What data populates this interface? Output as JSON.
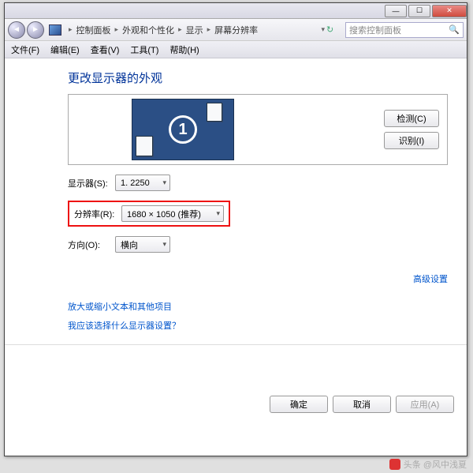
{
  "breadcrumbs": {
    "items": [
      "控制面板",
      "外观和个性化",
      "显示",
      "屏幕分辨率"
    ]
  },
  "search": {
    "placeholder": "搜索控制面板"
  },
  "menu": {
    "file": "文件(F)",
    "edit": "编辑(E)",
    "view": "查看(V)",
    "tools": "工具(T)",
    "help": "帮助(H)"
  },
  "page": {
    "title": "更改显示器的外观",
    "monitor_number": "1",
    "detect_btn": "检测(C)",
    "identify_btn": "识别(I)"
  },
  "form": {
    "display_label": "显示器(S):",
    "display_value": "1. 2250",
    "resolution_label": "分辨率(R):",
    "resolution_value": "1680 × 1050 (推荐)",
    "orientation_label": "方向(O):",
    "orientation_value": "横向"
  },
  "links": {
    "advanced": "高级设置",
    "text_size": "放大或缩小文本和其他项目",
    "which_settings": "我应该选择什么显示器设置？"
  },
  "buttons": {
    "ok": "确定",
    "cancel": "取消",
    "apply": "应用(A)"
  },
  "watermark": "头条 @风中浅夏"
}
